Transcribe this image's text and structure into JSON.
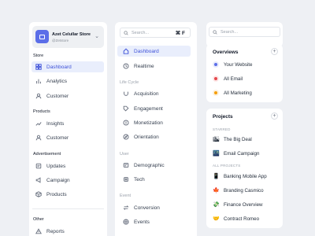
{
  "sidebar": {
    "store_name": "Azet Celullar Store",
    "store_handle": "@Zetstore",
    "sections": [
      {
        "title": "Store",
        "items": [
          {
            "label": "Dashboard",
            "icon": "grid-icon",
            "active": true
          },
          {
            "label": "Analytics",
            "icon": "bar-chart-icon"
          },
          {
            "label": "Customer",
            "icon": "user-icon"
          }
        ]
      },
      {
        "title": "Products",
        "items": [
          {
            "label": "Insights",
            "icon": "insights-icon"
          },
          {
            "label": "Customer",
            "icon": "user-icon"
          }
        ]
      },
      {
        "title": "Advertisement",
        "items": [
          {
            "label": "Updates",
            "icon": "updates-icon"
          },
          {
            "label": "Campaign",
            "icon": "megaphone-icon"
          },
          {
            "label": "Products",
            "icon": "box-icon"
          }
        ]
      },
      {
        "title": "Other",
        "items": [
          {
            "label": "Reports",
            "icon": "warning-icon"
          }
        ]
      }
    ]
  },
  "nav": {
    "search_placeholder": "Search...",
    "shortcut": "⌘ F",
    "top_items": [
      {
        "label": "Dashboard",
        "icon": "home-icon",
        "active": true
      },
      {
        "label": "Realtime",
        "icon": "clock-icon"
      }
    ],
    "sections": [
      {
        "title": "Life Cycle",
        "items": [
          {
            "label": "Acquisition",
            "icon": "magnet-icon"
          },
          {
            "label": "Engagement",
            "icon": "tag-icon"
          },
          {
            "label": "Monetization",
            "icon": "coin-icon"
          },
          {
            "label": "Orientation",
            "icon": "compass-icon"
          }
        ]
      },
      {
        "title": "User",
        "items": [
          {
            "label": "Demographic",
            "icon": "demographic-icon"
          },
          {
            "label": "Tech",
            "icon": "tech-icon"
          }
        ]
      },
      {
        "title": "Event",
        "items": [
          {
            "label": "Conversion",
            "icon": "conversion-icon"
          },
          {
            "label": "Events",
            "icon": "events-icon"
          }
        ]
      }
    ]
  },
  "right": {
    "search_placeholder": "Search...",
    "overviews_title": "Overviews",
    "overviews": [
      {
        "label": "Your Website",
        "color": "#5b6ee8",
        "icon": "website-icon"
      },
      {
        "label": "All Email",
        "color": "#e5484d",
        "icon": "email-icon"
      },
      {
        "label": "All Marketing",
        "color": "#f59e0b",
        "icon": "marketing-icon"
      }
    ],
    "projects_title": "Projects",
    "starred_label": "STARRED",
    "starred": [
      {
        "label": "The Big Deal",
        "emoji": "🏙"
      },
      {
        "label": "Email Campaign",
        "emoji": "🌃"
      }
    ],
    "all_projects_label": "ALL PROJECTS",
    "all_projects": [
      {
        "label": "Banking Mobile App",
        "emoji": "📱"
      },
      {
        "label": "Branding Casmico",
        "emoji": "🍁"
      },
      {
        "label": "Finance Overview",
        "emoji": "💸"
      },
      {
        "label": "Contract Romeo",
        "emoji": "🤝"
      }
    ]
  }
}
